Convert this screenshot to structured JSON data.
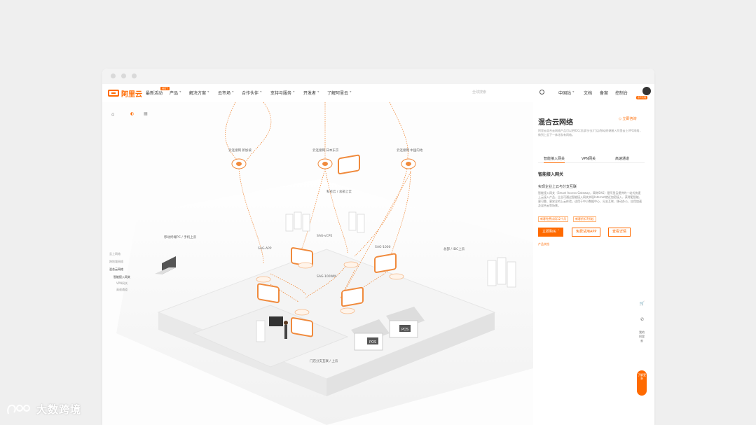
{
  "nav": {
    "logo_text": "阿里云",
    "hot_badge": "HOT",
    "items": [
      "最新活动",
      "产品",
      "解决方案",
      "云市场",
      "合作伙伴",
      "支持与服务",
      "开发者",
      "了解阿里云"
    ],
    "search_placeholder": "全球搜索",
    "right_items": [
      "中国站",
      "文档",
      "备案",
      "控制台"
    ],
    "avatar_badge": "账号管理"
  },
  "diagram": {
    "clouds": [
      "云连接网 新加坡",
      "云连接网 日本东京",
      "云连接网 中国内地"
    ],
    "labels": {
      "private": "私有云 / 总部上云",
      "mobile": "移动终端PC / 手机上云",
      "sag_app": "SAG-APP",
      "sag_vcpe": "SAG-vCPE",
      "sag_1000": "SAG-1000",
      "sag_100wm": "SAG-100WM",
      "idc": "总部 / IDC上云",
      "store": "门店分支互联 / 上云",
      "pos1": "POS",
      "pos2": "POS"
    },
    "legend": {
      "items": [
        "云上网络",
        "跨地域网络",
        "混合云网络"
      ],
      "subitems": [
        "智能接入网关",
        "VPN网关",
        "高速通道"
      ]
    }
  },
  "panel": {
    "title": "混合云网络",
    "consult": "立即咨询",
    "desc": "阿里云混合云网络产品可以把IDC/总部/分支/门店/移动终端接入阿里云上VPC网络，做到上云下一体化私有网络。",
    "tabs": [
      "智能接入网关",
      "VPN网关",
      "高速通道"
    ],
    "sub_title": "智能接入网关",
    "heading": "实现企业上云与分支互联",
    "text": "智能接入网关（Smart Access Gateway，简称SAG）是阿里云提供的一站式快速上云接入产品，企业可通过智能接入网关实现Internet就近加密接入，获得更智能、更可靠、更安全的上云体验。适用于中小数据中心、分支互联、移动办公、应用加速及混合云等场景。",
    "tags": [
      "新客免费试用12个月",
      "新客折扣7折起"
    ],
    "buttons": [
      "立即购买",
      "免费试用APP",
      "查看详情"
    ],
    "doc_link": "产品文档"
  },
  "float": {
    "my_aliyun": "我的阿里云",
    "consult": "了解更多"
  },
  "watermark": "大数跨境",
  "colors": {
    "accent": "#ff6a00"
  }
}
